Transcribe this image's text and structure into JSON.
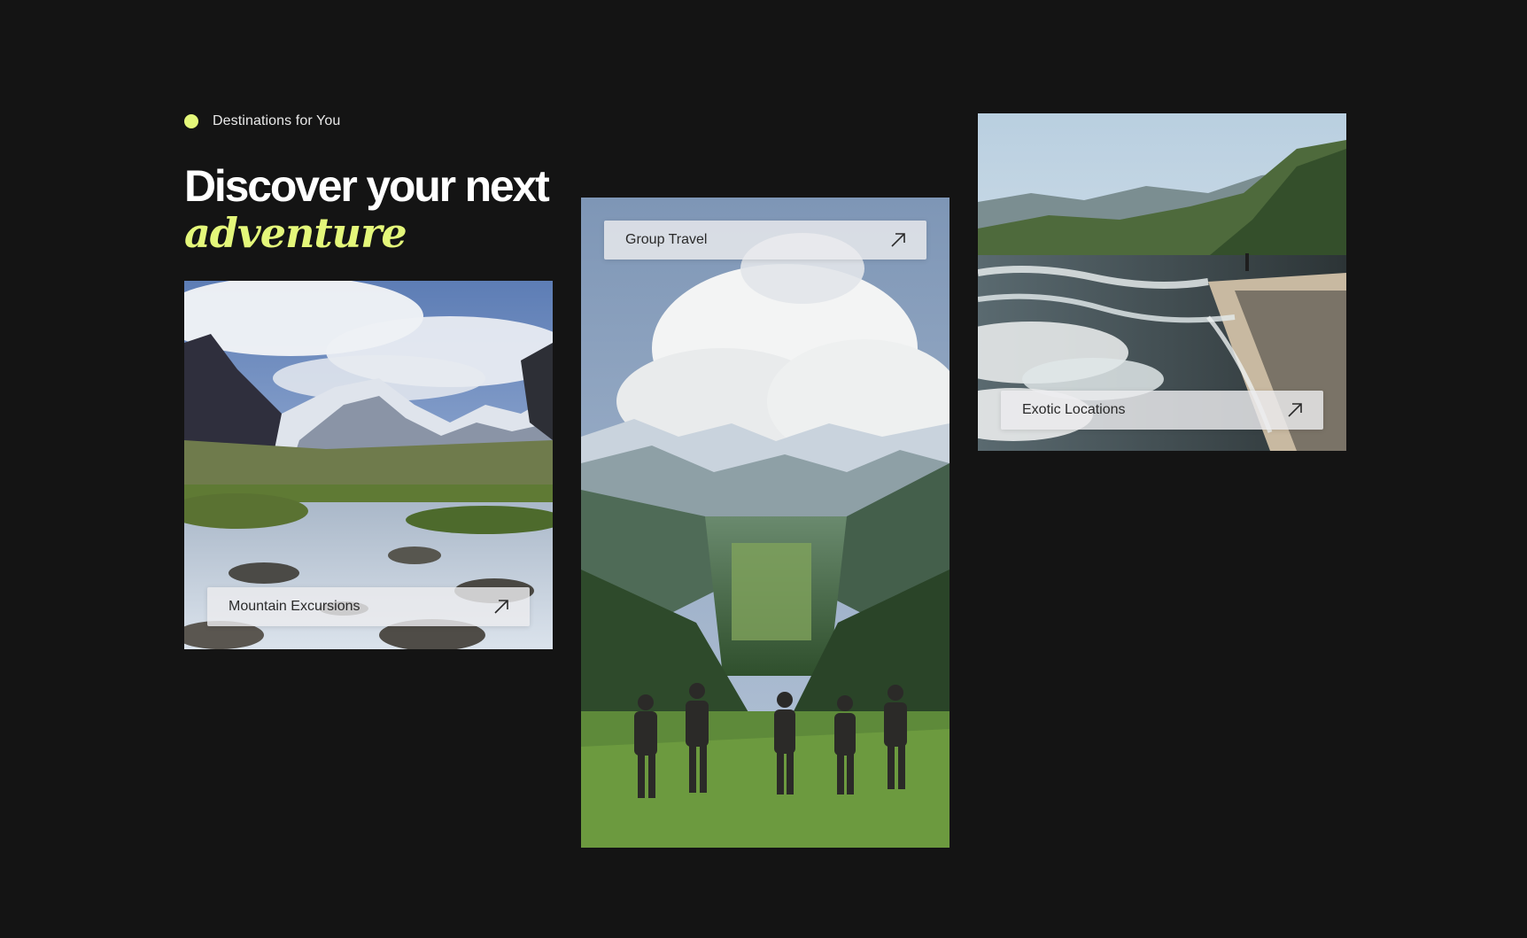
{
  "section": {
    "eyebrow": "Destinations for You",
    "heading_line1": "Discover your next",
    "heading_line2": "adventure"
  },
  "colors": {
    "background": "#141414",
    "accent": "#e4f77a",
    "pill_background": "#ececee"
  },
  "cards": [
    {
      "label": "Mountain Excursions",
      "icon": "arrow-up-right-icon",
      "image": "mountain valley with snowy peaks and rocky stream"
    },
    {
      "label": "Group Travel",
      "icon": "arrow-up-right-icon",
      "image": "group of hikers overlooking green valley under clouds"
    },
    {
      "label": "Exotic Locations",
      "icon": "arrow-up-right-icon",
      "image": "tropical beach with waves and forested hills"
    }
  ]
}
